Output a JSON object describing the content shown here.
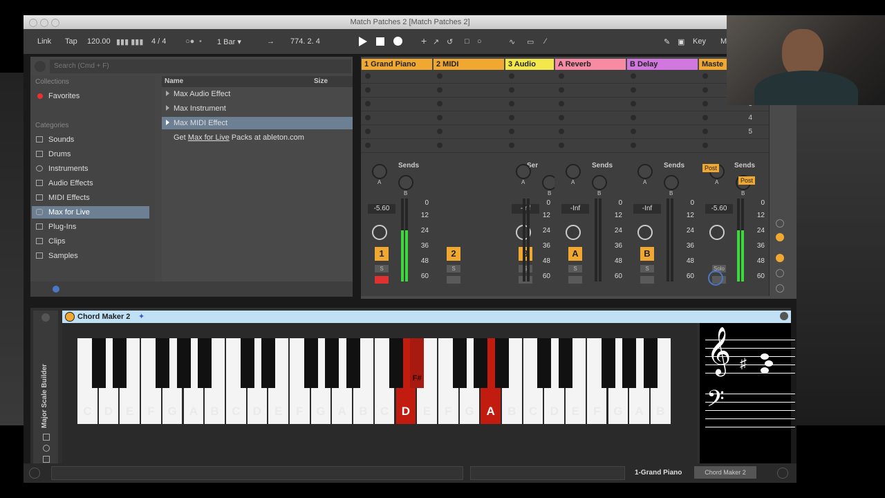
{
  "window": {
    "title": "Match Patches 2  [Match Patches 2]"
  },
  "control_bar": {
    "link": "Link",
    "tap": "Tap",
    "tempo": "120.00",
    "time_sig": "4 / 4",
    "quantize": "1 Bar",
    "position": "774.  2.  4",
    "key": "Key",
    "midi": "M"
  },
  "browser": {
    "search_placeholder": "Search (Cmd + F)",
    "collections_header": "Collections",
    "favorites": "Favorites",
    "categories_header": "Categories",
    "categories": [
      {
        "label": "Sounds",
        "icon": "note-icon"
      },
      {
        "label": "Drums",
        "icon": "grid-icon"
      },
      {
        "label": "Instruments",
        "icon": "clock-icon"
      },
      {
        "label": "Audio Effects",
        "icon": "waveform-icon"
      },
      {
        "label": "MIDI Effects",
        "icon": "midi-icon"
      },
      {
        "label": "Max for Live",
        "icon": "max-icon"
      },
      {
        "label": "Plug-Ins",
        "icon": "plug-icon"
      },
      {
        "label": "Clips",
        "icon": "clip-icon"
      },
      {
        "label": "Samples",
        "icon": "sample-icon"
      }
    ],
    "selected_category": 5,
    "columns": {
      "name": "Name",
      "size": "Size"
    },
    "items": [
      "Max Audio Effect",
      "Max Instrument",
      "Max MIDI Effect"
    ],
    "selected_item": 2,
    "get_more": {
      "prefix": "Get",
      "link": "Max for Live",
      "suffix": "Packs at ableton.com"
    }
  },
  "session": {
    "tracks": [
      {
        "name": "1 Grand Piano",
        "color": "#f0a830",
        "sends_label": "Sends",
        "volume": "-5.60",
        "number": "1",
        "solo": "S",
        "meter": 0.62
      },
      {
        "name": "2 MIDI",
        "color": "#f0a830",
        "sends_label": "",
        "volume": "",
        "number": "2",
        "solo": "S",
        "meter": 0
      },
      {
        "name": "3 Audio",
        "color": "#f2e84c",
        "sends_label": "Ser",
        "volume": "-Inf",
        "number": "3",
        "solo": "S",
        "meter": 0
      },
      {
        "name": "A Reverb",
        "color": "#f78ba3",
        "sends_label": "Sends",
        "volume": "-Inf",
        "number": "A",
        "solo": "S",
        "meter": 0
      },
      {
        "name": "B Delay",
        "color": "#d276e0",
        "sends_label": "Sends",
        "volume": "-Inf",
        "number": "B",
        "solo": "S",
        "meter": 0
      },
      {
        "name": "Maste",
        "color": "#f0a830",
        "sends_label": "Sends",
        "volume": "-5.60",
        "number": "",
        "solo": "Solo",
        "meter": 0.62
      }
    ],
    "scale_marks": [
      "0",
      "12",
      "24",
      "36",
      "48",
      "60"
    ],
    "send_letters": {
      "a": "A",
      "b": "B"
    },
    "post_label": "Post",
    "master_scenes": [
      "3",
      "4",
      "5"
    ]
  },
  "device": {
    "title": "Chord Maker 2",
    "side_label": "Major Scale Builder",
    "white_keys": [
      "C",
      "D",
      "E",
      "F",
      "G",
      "A",
      "B",
      "C",
      "D",
      "E",
      "F",
      "G",
      "A",
      "B",
      "C",
      "D",
      "E",
      "F",
      "G",
      "A",
      "B",
      "C",
      "D",
      "E",
      "F",
      "G",
      "A",
      "B"
    ],
    "highlighted_white": [
      15,
      19
    ],
    "highlighted_black": [
      11
    ],
    "black_label": "F#",
    "colors": {
      "highlight": "#c21b10",
      "title_bar": "#bfe0f5",
      "accent": "#f0a830"
    }
  },
  "status_bar": {
    "track": "1-Grand Piano",
    "device": "Chord Maker 2"
  }
}
